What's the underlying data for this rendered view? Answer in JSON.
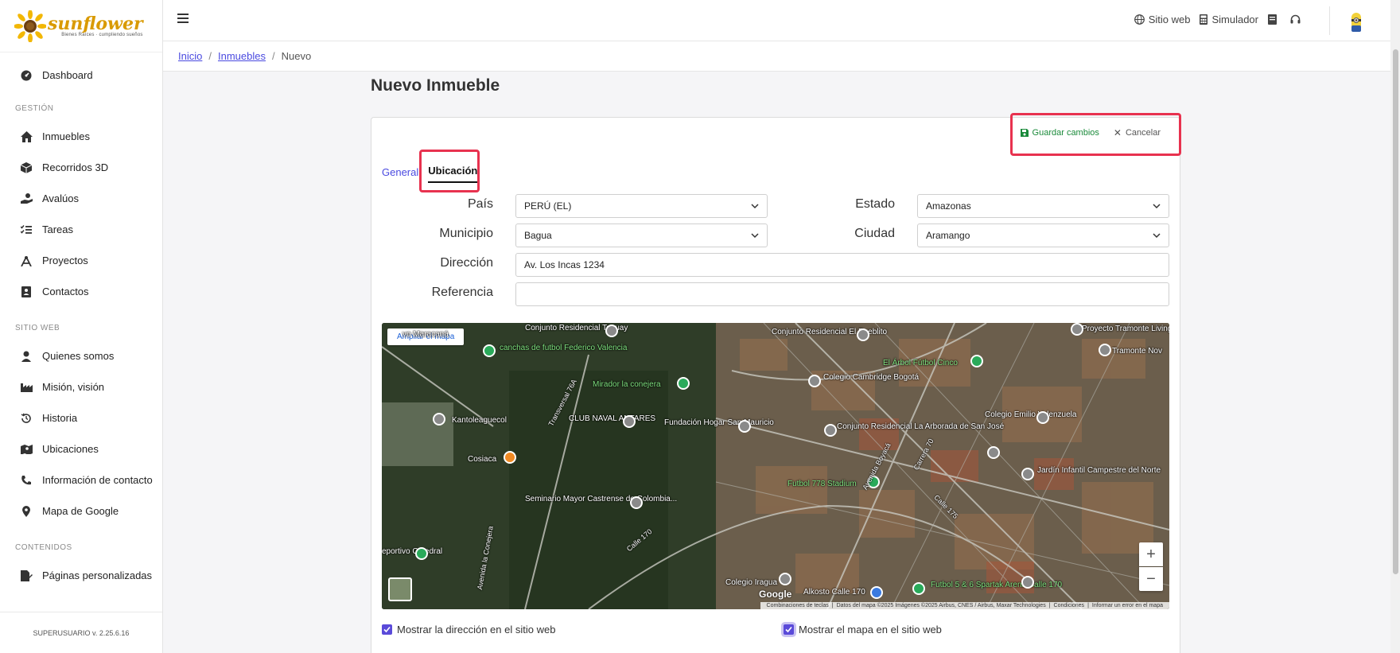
{
  "brand": {
    "name": "sunflower",
    "tagline": "Bienes Raíces · cumpliendo sueños"
  },
  "sidebar": {
    "items": [
      {
        "label": "Dashboard",
        "icon": "dashboard-icon"
      },
      {
        "section": "GESTIÓN"
      },
      {
        "label": "Inmuebles",
        "icon": "home-icon"
      },
      {
        "label": "Recorridos 3D",
        "icon": "cube-icon"
      },
      {
        "label": "Avalúos",
        "icon": "hand-coin-icon"
      },
      {
        "label": "Tareas",
        "icon": "list-check-icon"
      },
      {
        "label": "Proyectos",
        "icon": "compass-icon"
      },
      {
        "label": "Contactos",
        "icon": "contact-card-icon"
      },
      {
        "section": "SITIO WEB"
      },
      {
        "label": "Quienes somos",
        "icon": "user-tie-icon"
      },
      {
        "label": "Misión, visión",
        "icon": "industry-icon"
      },
      {
        "label": "Historia",
        "icon": "history-icon"
      },
      {
        "label": "Ubicaciones",
        "icon": "map-location-icon"
      },
      {
        "label": "Información de contacto",
        "icon": "phone-icon"
      },
      {
        "label": "Mapa de Google",
        "icon": "map-pin-icon"
      },
      {
        "section": "CONTENIDOS"
      },
      {
        "label": "Páginas personalizadas",
        "icon": "page-edit-icon"
      }
    ],
    "footer": "SUPERUSUARIO v. 2.25.6.16"
  },
  "topbar": {
    "sitio_web": "Sitio web",
    "simulador": "Simulador"
  },
  "breadcrumb": {
    "inicio": "Inicio",
    "inmuebles": "Inmuebles",
    "current": "Nuevo"
  },
  "page": {
    "title": "Nuevo Inmueble"
  },
  "actions": {
    "save": "Guardar cambios",
    "cancel": "Cancelar"
  },
  "tabs": {
    "general": "General",
    "ubicacion": "Ubicación"
  },
  "form": {
    "pais_label": "País",
    "pais_value": "PERÚ (EL)",
    "estado_label": "Estado",
    "estado_value": "Amazonas",
    "municipio_label": "Municipio",
    "municipio_value": "Bagua",
    "ciudad_label": "Ciudad",
    "ciudad_value": "Aramango",
    "direccion_label": "Dirección",
    "direccion_value": "Av. Los Incas 1234",
    "referencia_label": "Referencia",
    "referencia_value": ""
  },
  "map": {
    "ampliar": "Ampliar el mapa",
    "attribution": [
      "Combinaciones de teclas",
      "Datos del mapa ©2025 Imágenes ©2025 Airbus, CNES / Airbus, Maxar Technologies",
      "Condiciones",
      "Informar un error en el mapa"
    ],
    "google": "Google",
    "labels": [
      "vo Maracaná",
      "Conjunto Residencial Taguay",
      "canchas de futbol Federico Valencia",
      "Conjunto Residencial El Pueblito",
      "El Árbol Fútbol Cinco",
      "Proyecto Tramonte Living",
      "Tramonte Nov",
      "Colegio Cambridge Bogotá",
      "Mirador la conejera",
      "Kantoleaguecol",
      "CLUB NAVAL ANTARES",
      "Fundación Hogar San Mauricio",
      "Conjunto Residencial La Arborada de San José",
      "Colegio Emilio Valenzuela",
      "Cosiaca",
      "Jardín Infantil Campestre del Norte",
      "Futbol 778 Stadium",
      "Seminario Mayor Castrense de Colombia...",
      "Colegio Iragua",
      "Alkosto Calle 170",
      "Futbol 5 & 6 Spartak Arena Calle 170",
      "eportivo Catedral",
      "Transversal 76A",
      "Calle 170",
      "Avenida Boyacá",
      "Calle 175",
      "Carrera 70",
      "Avenida la Conejera"
    ]
  },
  "checks": {
    "show_address": "Mostrar la dirección en el sitio web",
    "show_map": "Mostrar el mapa en el sitio web"
  },
  "colors": {
    "accent": "#5a4ad9",
    "link": "#4a4ae0",
    "save": "#1a8a3a",
    "highlight": "#e8324f"
  }
}
